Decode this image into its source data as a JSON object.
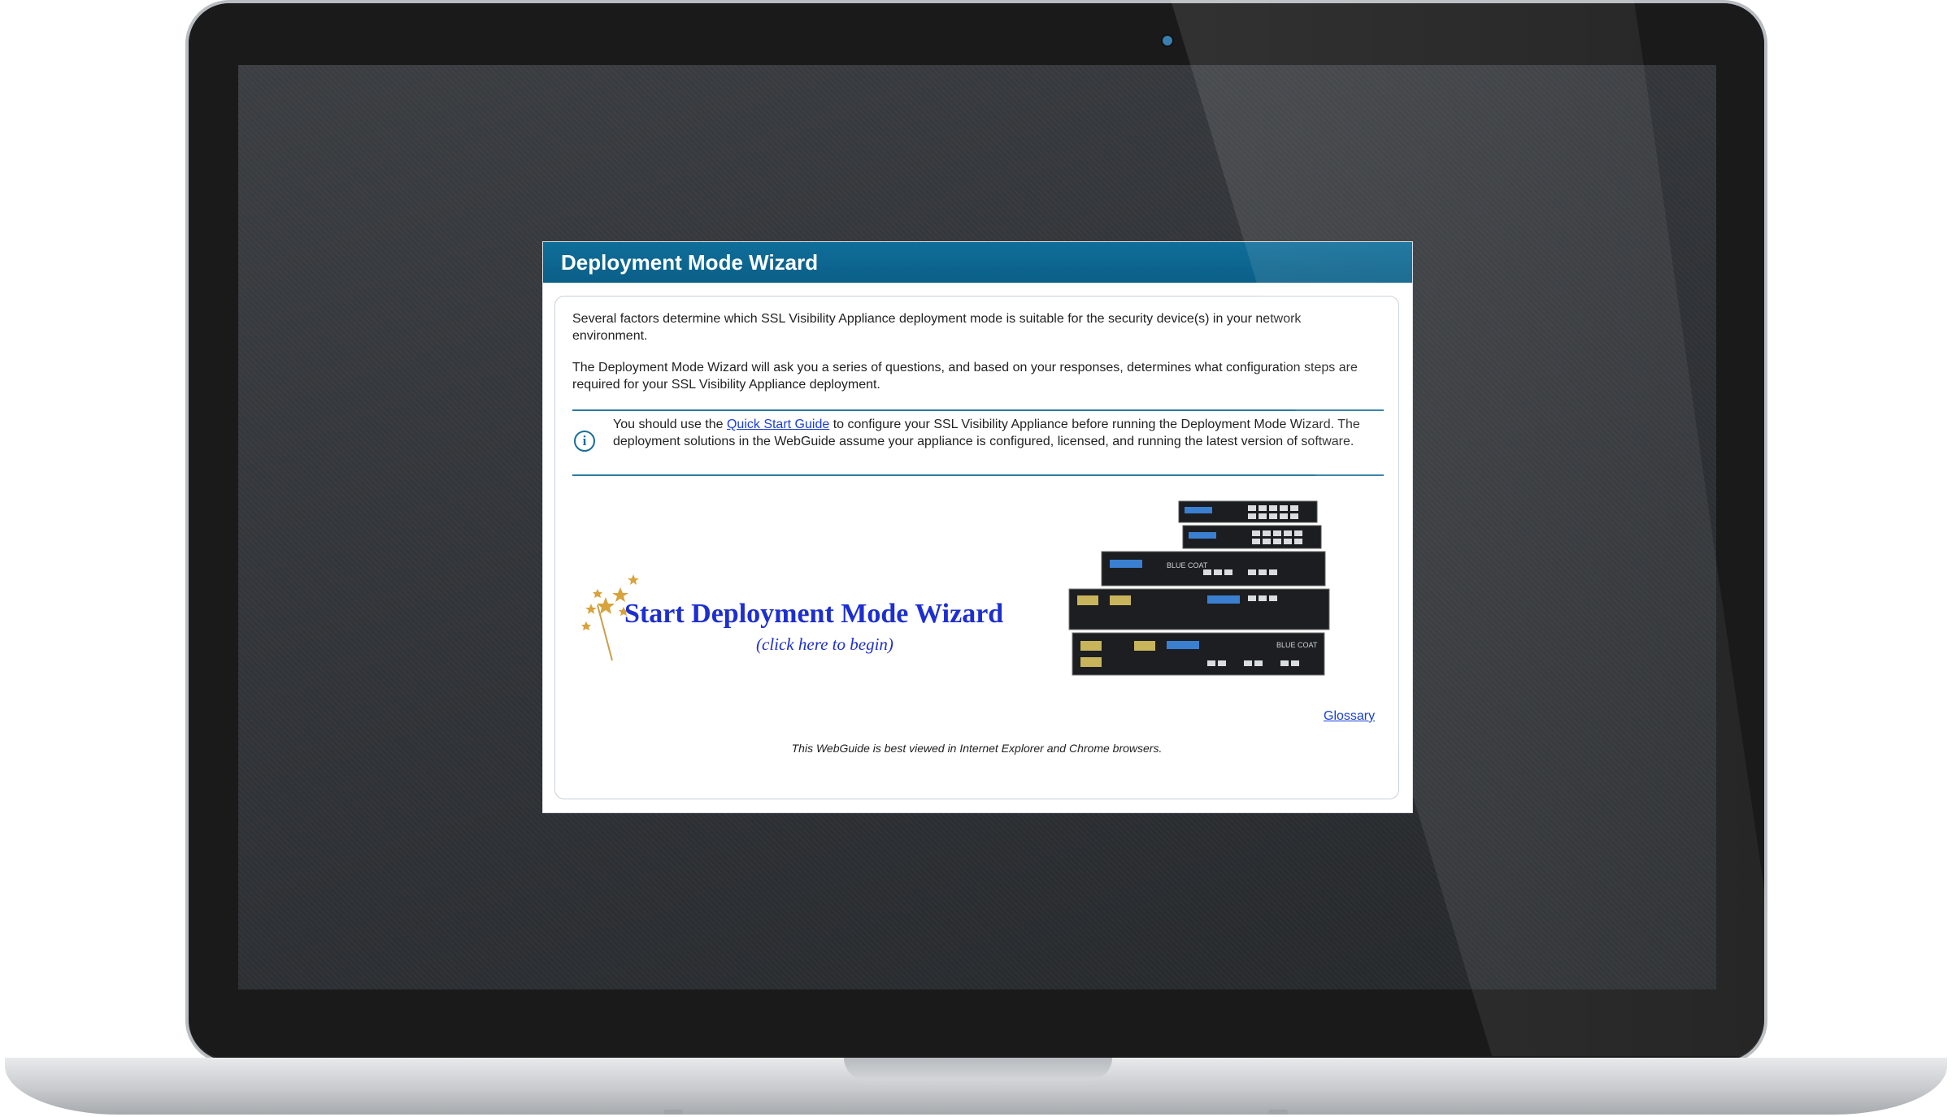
{
  "wizard": {
    "title": "Deployment Mode Wizard",
    "intro_1": "Several factors determine which SSL Visibility Appliance deployment mode is suitable for the security device(s) in your network environment.",
    "intro_2": "The Deployment Mode Wizard will ask you a series of questions, and based on your responses, determines what configuration steps are required for your SSL Visibility Appliance deployment.",
    "note": {
      "icon": "info-icon",
      "prefix": "You should use the ",
      "link_label": "Quick Start Guide",
      "suffix": " to configure your SSL Visibility Appliance before running the Deployment Mode Wizard. The deployment solutions in the WebGuide assume your appliance is configured, licensed, and running the latest version of software."
    },
    "start_title": "Start Deployment Mode Wizard",
    "start_subtitle": "(click here to begin)",
    "appliance_brand": "BLUE COAT",
    "glossary_label": "Glossary",
    "footnote": "This WebGuide is best viewed in Internet Explorer and Chrome browsers."
  },
  "colors": {
    "header": "#0a6790",
    "link": "#1a3fd6",
    "start_text": "#1d2fd0",
    "note_rule": "#2a7aa0"
  }
}
